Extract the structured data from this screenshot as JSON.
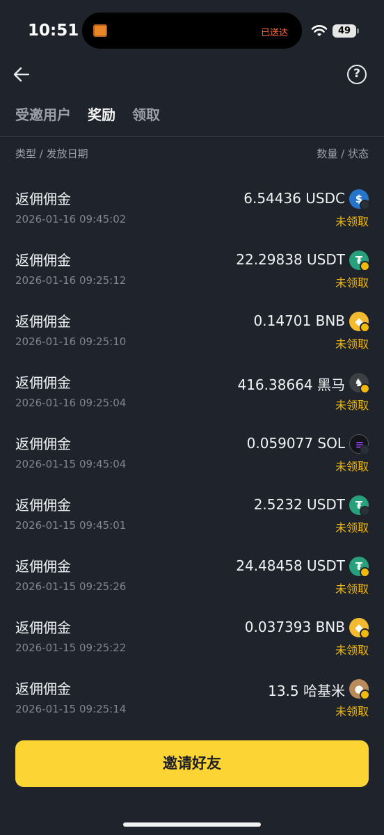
{
  "status_bar": {
    "time": "10:51",
    "island_text": "已送达",
    "battery": "49"
  },
  "tabs": [
    {
      "label": "受邀用户",
      "active": false
    },
    {
      "label": "奖励",
      "active": true
    },
    {
      "label": "领取",
      "active": false
    }
  ],
  "table_header": {
    "left": "类型 / 发放日期",
    "right": "数量 / 状态"
  },
  "rewards": [
    {
      "type": "返佣佣金",
      "date": "2026-01-16 09:45:02",
      "amount": "6.54436 USDC",
      "status": "未领取",
      "coin_icon": "usdc-icon"
    },
    {
      "type": "返佣佣金",
      "date": "2026-01-16 09:25:12",
      "amount": "22.29838 USDT",
      "status": "未领取",
      "coin_icon": "usdt-icon"
    },
    {
      "type": "返佣佣金",
      "date": "2026-01-16 09:25:10",
      "amount": "0.14701 BNB",
      "status": "未领取",
      "coin_icon": "bnb-icon"
    },
    {
      "type": "返佣佣金",
      "date": "2026-01-16 09:25:04",
      "amount": "416.38664 黑马",
      "status": "未领取",
      "coin_icon": "heima-token-icon"
    },
    {
      "type": "返佣佣金",
      "date": "2026-01-15 09:45:04",
      "amount": "0.059077 SOL",
      "status": "未领取",
      "coin_icon": "sol-icon"
    },
    {
      "type": "返佣佣金",
      "date": "2026-01-15 09:45:01",
      "amount": "2.5232 USDT",
      "status": "未领取",
      "coin_icon": "usdt-icon"
    },
    {
      "type": "返佣佣金",
      "date": "2026-01-15 09:25:26",
      "amount": "24.48458 USDT",
      "status": "未领取",
      "coin_icon": "usdt-icon"
    },
    {
      "type": "返佣佣金",
      "date": "2026-01-15 09:25:22",
      "amount": "0.037393 BNB",
      "status": "未领取",
      "coin_icon": "bnb-icon"
    },
    {
      "type": "返佣佣金",
      "date": "2026-01-15 09:25:14",
      "amount": "13.5 哈基米",
      "status": "未领取",
      "coin_icon": "hajimi-token-icon"
    }
  ],
  "invite_button": "邀请好友",
  "colors": {
    "background": "#1f232b",
    "accent_yellow": "#fcd535",
    "status_yellow": "#f0b90b"
  }
}
